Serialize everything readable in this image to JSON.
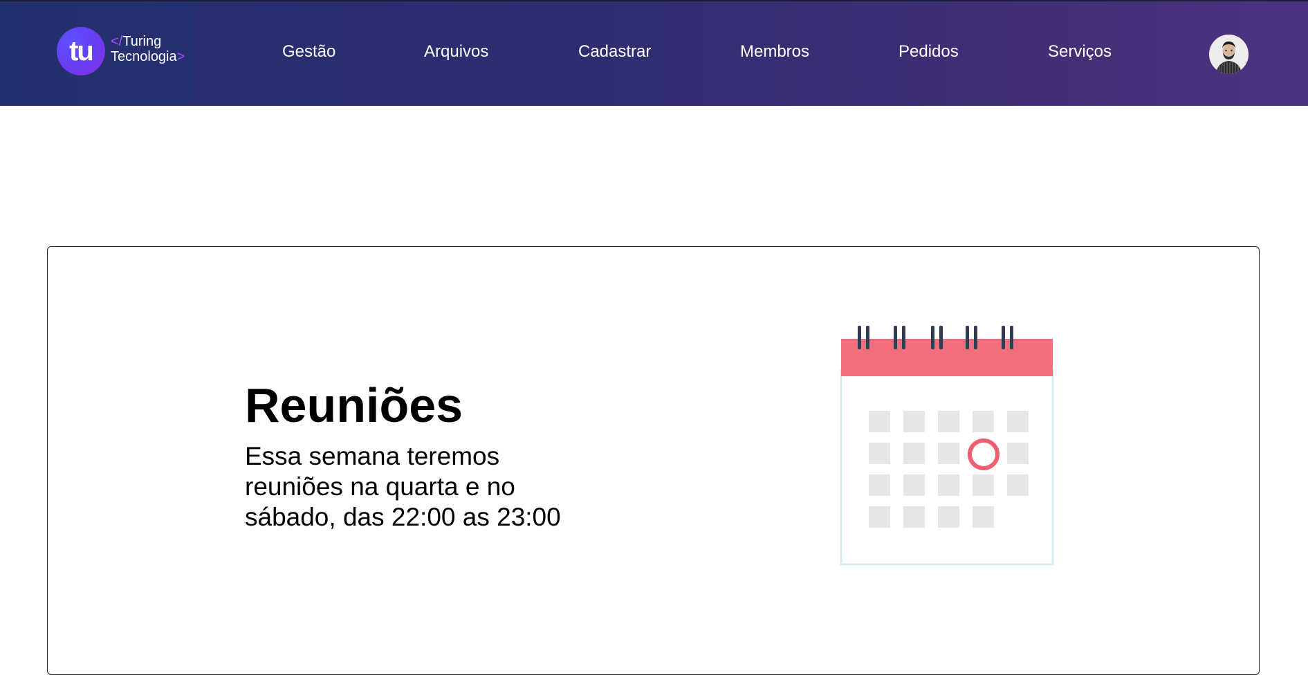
{
  "header": {
    "logo": {
      "mark": "tu",
      "line1_tag": "</",
      "line1_text": "Turing",
      "line2_text": "Tecnologia",
      "line2_tag": ">"
    },
    "nav": [
      {
        "label": "Gestão"
      },
      {
        "label": "Arquivos"
      },
      {
        "label": "Cadastrar"
      },
      {
        "label": "Membros"
      },
      {
        "label": "Pedidos"
      },
      {
        "label": "Serviços"
      }
    ]
  },
  "card": {
    "title": "Reuniões",
    "text": "Essa semana teremos reuniões na quarta e no sábado, das 22:00 as 23:00"
  },
  "colors": {
    "header_gradient_start": "#23306e",
    "header_gradient_end": "#4d3280",
    "logo_accent": "#b04bff",
    "calendar_header": "#f26d7d",
    "calendar_cell": "#e6e6e6"
  },
  "icons": {
    "avatar": "user-avatar",
    "calendar": "calendar-icon"
  }
}
